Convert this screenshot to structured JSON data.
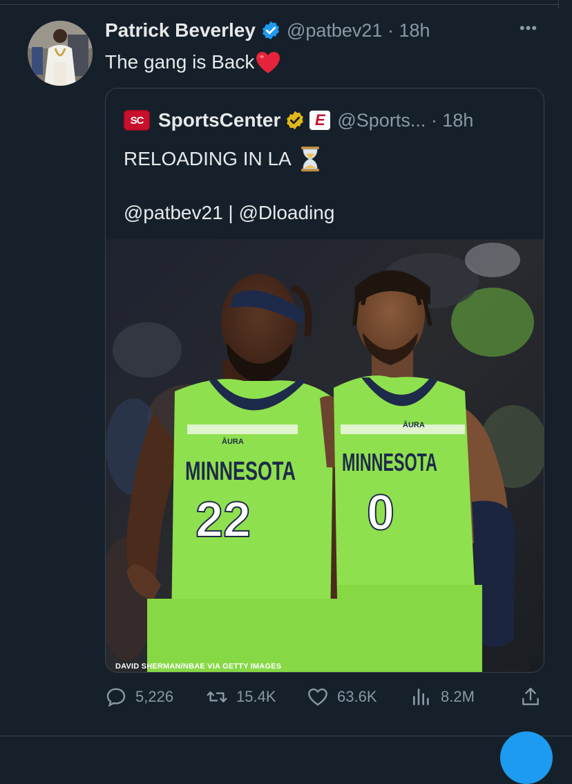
{
  "tweet": {
    "author_name": "Patrick Beverley",
    "author_handle": "@patbev21 · 18h",
    "text": "The gang is Back",
    "more_label": "•••"
  },
  "quoted": {
    "logo_text": "SC",
    "author_name": "SportsCenter",
    "badge_text": "E",
    "author_handle": "@Sports... · 18h",
    "line1": "RELOADING IN LA",
    "line2": "@patbev21 | @Dloading"
  },
  "photo": {
    "credit": "DAVID SHERMAN/NBAE VIA GETTY IMAGES",
    "jersey_left": {
      "brand": "ĀURA",
      "team": "MINNESOTA",
      "number": "22"
    },
    "jersey_right": {
      "brand": "ĀURA",
      "team": "MINNESOTA",
      "number": "0"
    }
  },
  "actions": {
    "replies": "5,226",
    "retweets": "15.4K",
    "likes": "63.6K",
    "views": "8.2M"
  },
  "colors": {
    "background": "#15202b",
    "text": "#e7e9ea",
    "muted": "#8b98a5",
    "border": "#38444d",
    "verified_blue": "#1d9bf0",
    "jersey_green": "#8fe04e"
  }
}
